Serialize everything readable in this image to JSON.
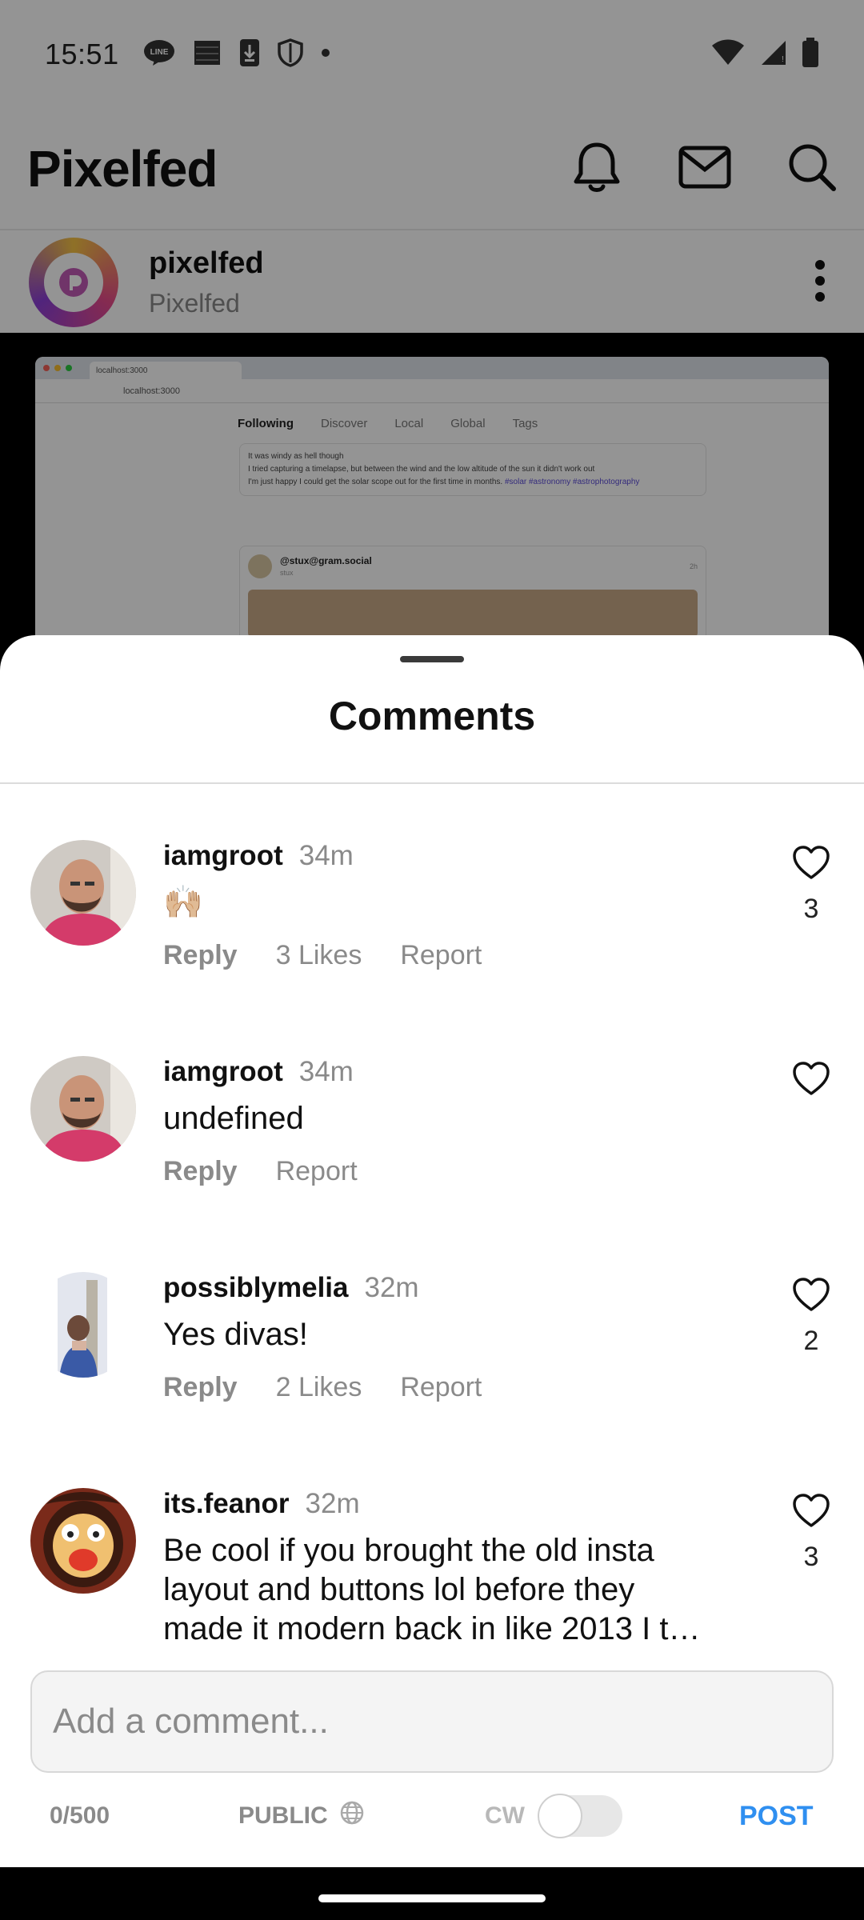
{
  "status_bar": {
    "time": "15:51",
    "left_icons": [
      "line-icon",
      "notification-icon",
      "download-icon",
      "shield-icon",
      "dot-icon"
    ],
    "right_icons": [
      "wifi-icon",
      "signal-icon",
      "battery-icon"
    ]
  },
  "app": {
    "title": "Pixelfed",
    "actions": [
      "bell-icon",
      "mail-icon",
      "search-icon"
    ]
  },
  "post": {
    "username": "pixelfed",
    "display_name": "Pixelfed",
    "media": {
      "browser_tab": "localhost:3000",
      "browser_url": "localhost:3000",
      "nav": [
        "Following",
        "Discover",
        "Local",
        "Global",
        "Tags"
      ],
      "card1_lines": [
        "It was windy as hell though",
        "I tried capturing a timelapse, but between the wind and the low altitude of the sun it didn't work out",
        "I'm just happy I could get the solar scope out for the first time in months."
      ],
      "card1_tags": "#solar #astronomy #astrophotography",
      "card2_user": "@stux@gram.social",
      "card2_sub": "stux",
      "card2_time": "2h"
    }
  },
  "sheet": {
    "title": "Comments"
  },
  "comments": [
    {
      "username": "iamgroot",
      "time": "34m",
      "text": "🙌🏼",
      "reply": "Reply",
      "likes_label": "3 Likes",
      "report": "Report",
      "like_count": "3"
    },
    {
      "username": "iamgroot",
      "time": "34m",
      "text": "undefined",
      "reply": "Reply",
      "likes_label": "",
      "report": "Report",
      "like_count": ""
    },
    {
      "username": "possiblymelia",
      "time": "32m",
      "text": "Yes divas!",
      "reply": "Reply",
      "likes_label": "2 Likes",
      "report": "Report",
      "like_count": "2"
    },
    {
      "username": "its.feanor",
      "time": "32m",
      "text": "Be cool if you brought the old insta layout and buttons lol before they made it modern back in like 2013 I t…",
      "reply": "",
      "likes_label": "",
      "report": "",
      "like_count": "3"
    }
  ],
  "composer": {
    "placeholder": "Add a comment...",
    "counter": "0/500",
    "visibility": "PUBLIC",
    "cw_label": "CW",
    "cw_enabled": false,
    "post_label": "POST",
    "accent_color": "#2f8ff0"
  }
}
